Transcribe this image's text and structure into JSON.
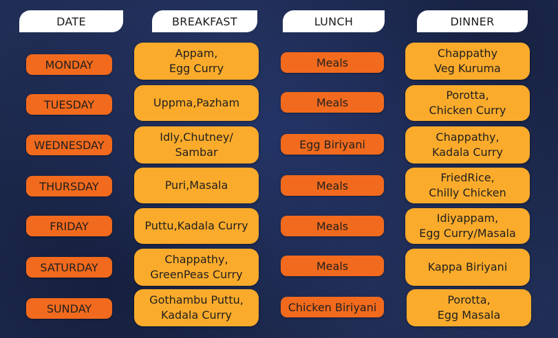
{
  "headers": {
    "date": "DATE",
    "breakfast": "BREAKFAST",
    "lunch": "LUNCH",
    "dinner": "DINNER"
  },
  "rows": [
    {
      "day": "MONDAY",
      "breakfast": "Appam,\nEgg Curry",
      "lunch": "Meals",
      "dinner": "Chappathy\nVeg Kuruma"
    },
    {
      "day": "TUESDAY",
      "breakfast": "Uppma,Pazham",
      "lunch": "Meals",
      "dinner": "Porotta,\nChicken Curry"
    },
    {
      "day": "WEDNESDAY",
      "breakfast": "Idly,Chutney/\nSambar",
      "lunch": "Egg Biriyani",
      "dinner": "Chappathy,\nKadala Curry"
    },
    {
      "day": "THURSDAY",
      "breakfast": "Puri,Masala",
      "lunch": "Meals",
      "dinner": "FriedRice,\nChilly Chicken"
    },
    {
      "day": "FRIDAY",
      "breakfast": "Puttu,Kadala Curry",
      "lunch": "Meals",
      "dinner": "Idiyappam,\nEgg Curry/Masala"
    },
    {
      "day": "SATURDAY",
      "breakfast": "Chappathy,\nGreenPeas Curry",
      "lunch": "Meals",
      "dinner": "Kappa Biriyani"
    },
    {
      "day": "SUNDAY",
      "breakfast": "Gothambu Puttu,\nKadala Curry",
      "lunch": "Chicken Biriyani",
      "dinner": "Porotta,\nEgg Masala"
    }
  ],
  "colors": {
    "background": "#1c2a54",
    "header": "#ffffff",
    "day_pill": "#f26a1d",
    "meal_box": "#fbab2b",
    "lunch_pill": "#f26a1d"
  }
}
